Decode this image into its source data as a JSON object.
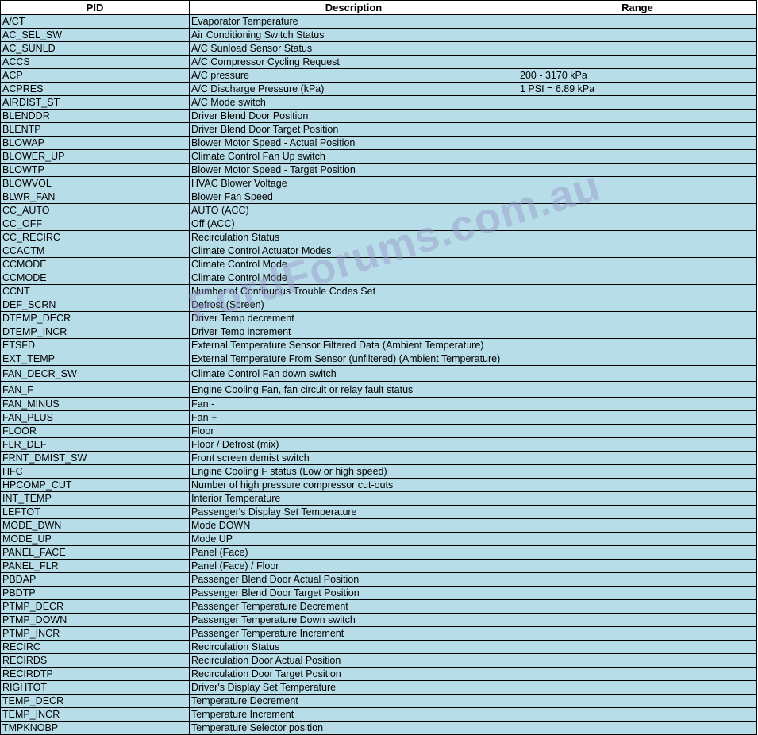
{
  "table": {
    "headers": [
      "PID",
      "Description",
      "Range"
    ],
    "rows": [
      [
        "A/CT",
        "Evaporator Temperature",
        ""
      ],
      [
        "AC_SEL_SW",
        "Air Conditioning Switch Status",
        ""
      ],
      [
        "AC_SUNLD",
        "A/C Sunload Sensor Status",
        ""
      ],
      [
        "ACCS",
        "A/C Compressor Cycling Request",
        ""
      ],
      [
        "ACP",
        "A/C pressure",
        "200 - 3170 kPa"
      ],
      [
        "ACPRES",
        "A/C Discharge Pressure (kPa)",
        "1 PSI = 6.89 kPa"
      ],
      [
        "AIRDIST_ST",
        "A/C Mode switch",
        ""
      ],
      [
        "BLENDDR",
        "Driver Blend Door Position",
        ""
      ],
      [
        "BLENTP",
        "Driver Blend Door Target Position",
        ""
      ],
      [
        "BLOWAP",
        "Blower Motor Speed - Actual Position",
        ""
      ],
      [
        "BLOWER_UP",
        "Climate Control Fan Up switch",
        ""
      ],
      [
        "BLOWTP",
        "Blower Motor Speed - Target Position",
        ""
      ],
      [
        "BLOWVOL",
        "HVAC Blower Voltage",
        ""
      ],
      [
        "BLWR_FAN",
        "Blower Fan Speed",
        ""
      ],
      [
        "CC_AUTO",
        "AUTO (ACC)",
        ""
      ],
      [
        "CC_OFF",
        "Off (ACC)",
        ""
      ],
      [
        "CC_RECIRC",
        "Recirculation Status",
        ""
      ],
      [
        "CCACTM",
        "Climate Control Actuator Modes",
        ""
      ],
      [
        "CCMODE",
        "Climate Control Mode",
        ""
      ],
      [
        "CCMODE",
        "Climate Control Mode",
        ""
      ],
      [
        "CCNT",
        "Number of Continuous Trouble Codes Set",
        ""
      ],
      [
        "DEF_SCRN",
        "Defrost (Screen)",
        ""
      ],
      [
        "DTEMP_DECR",
        "Driver Temp decrement",
        ""
      ],
      [
        "DTEMP_INCR",
        "Driver Temp increment",
        ""
      ],
      [
        "ETSFD",
        "External Temperature Sensor Filtered Data (Ambient Temperature)",
        ""
      ],
      [
        "EXT_TEMP",
        "External Temperature From Sensor (unfiltered) (Ambient Temperature)",
        ""
      ],
      [
        "FAN_DECR_SW",
        "Climate Control Fan down switch",
        ""
      ],
      [
        "FAN_F",
        "Engine Cooling Fan, fan circuit or relay fault status",
        ""
      ],
      [
        "FAN_MINUS",
        "Fan -",
        ""
      ],
      [
        "FAN_PLUS",
        "Fan +",
        ""
      ],
      [
        "FLOOR",
        "Floor",
        ""
      ],
      [
        "FLR_DEF",
        "Floor / Defrost (mix)",
        ""
      ],
      [
        "FRNT_DMIST_SW",
        "Front screen demist switch",
        ""
      ],
      [
        "HFC",
        "Engine Cooling F status (Low or high speed)",
        ""
      ],
      [
        "HPCOMP_CUT",
        "Number of high pressure compressor cut-outs",
        ""
      ],
      [
        "INT_TEMP",
        "Interior Temperature",
        ""
      ],
      [
        "LEFTOT",
        "Passenger's Display Set Temperature",
        ""
      ],
      [
        "MODE_DWN",
        "Mode DOWN",
        ""
      ],
      [
        "MODE_UP",
        "Mode UP",
        ""
      ],
      [
        "PANEL_FACE",
        "Panel (Face)",
        ""
      ],
      [
        "PANEL_FLR",
        "Panel (Face) / Floor",
        ""
      ],
      [
        "PBDAP",
        "Passenger Blend Door Actual Position",
        ""
      ],
      [
        "PBDTP",
        "Passenger Blend Door Target Position",
        ""
      ],
      [
        "PTMP_DECR",
        "Passenger Temperature Decrement",
        ""
      ],
      [
        "PTMP_DOWN",
        "Passenger Temperature Down switch",
        ""
      ],
      [
        "PTMP_INCR",
        "Passenger Temperature Increment",
        ""
      ],
      [
        "RECIRC",
        "Recirculation Status",
        ""
      ],
      [
        "RECIRDS",
        "Recirculation Door Actual Position",
        ""
      ],
      [
        "RECIRDTP",
        "Recirculation Door Target Position",
        ""
      ],
      [
        "RIGHTOT",
        "Driver's Display Set Temperature",
        ""
      ],
      [
        "TEMP_DECR",
        "Temperature Decrement",
        ""
      ],
      [
        "TEMP_INCR",
        "Temperature Increment",
        ""
      ],
      [
        "TMPKNOBP",
        "Temperature Selector position",
        ""
      ]
    ]
  },
  "watermark": "FordForums.com.au"
}
